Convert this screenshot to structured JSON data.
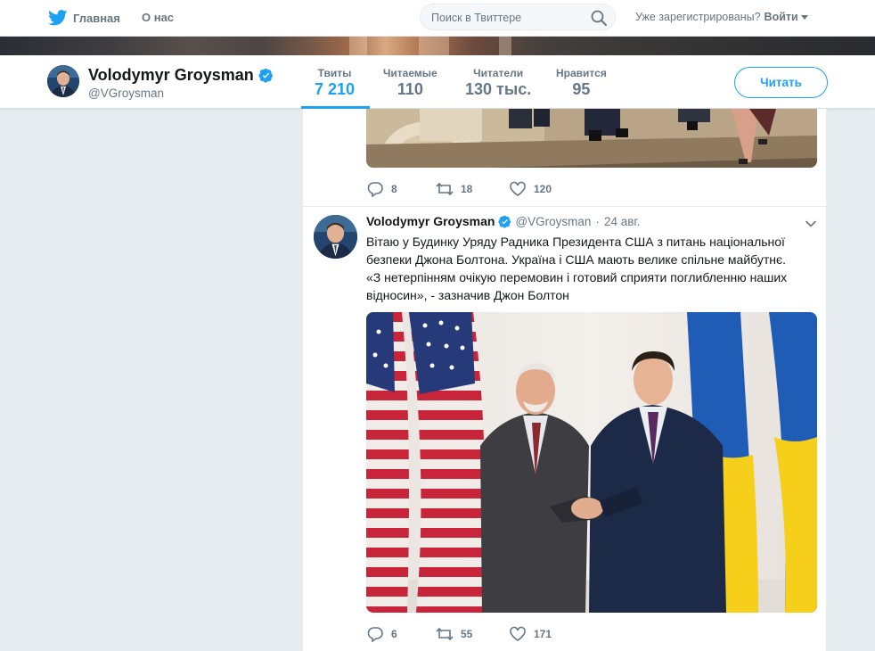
{
  "nav": {
    "home_label": "Главная",
    "about_label": "О нас",
    "search_placeholder": "Поиск в Твиттере",
    "already_registered": "Уже зарегистрированы?",
    "login_label": "Войти"
  },
  "profile": {
    "name": "Volodymyr Groysman",
    "handle": "@VGroysman",
    "stats": [
      {
        "label": "Твиты",
        "value": "7 210",
        "active": true
      },
      {
        "label": "Читаемые",
        "value": "110",
        "active": false
      },
      {
        "label": "Читатели",
        "value": "130 тыс.",
        "active": false
      },
      {
        "label": "Нравится",
        "value": "95",
        "active": false
      }
    ],
    "follow_label": "Читать"
  },
  "tweets": [
    {
      "actions": {
        "replies": "8",
        "retweets": "18",
        "likes": "120"
      }
    },
    {
      "author_name": "Volodymyr Groysman",
      "author_handle": "@VGroysman",
      "separator": "·",
      "time": "24 авг.",
      "text_lines": [
        "Вітаю у Будинку Уряду Радника Президента США з питань національної",
        "безпеки Джона Болтона. Україна і США мають велике спільне майбутнє.",
        "«З нетерпінням очікую перемовин і готовий сприяти поглибленню наших",
        "відносин», - зазначив Джон Болтон"
      ],
      "actions": {
        "replies": "6",
        "retweets": "55",
        "likes": "171"
      }
    }
  ],
  "colors": {
    "accent": "#1da1f2",
    "text_secondary": "#657786",
    "background": "#e6ecf0"
  },
  "icons": [
    "twitter-bird-icon",
    "search-icon",
    "verified-badge-icon",
    "reply-icon",
    "retweet-icon",
    "like-icon",
    "chevron-down-icon"
  ]
}
